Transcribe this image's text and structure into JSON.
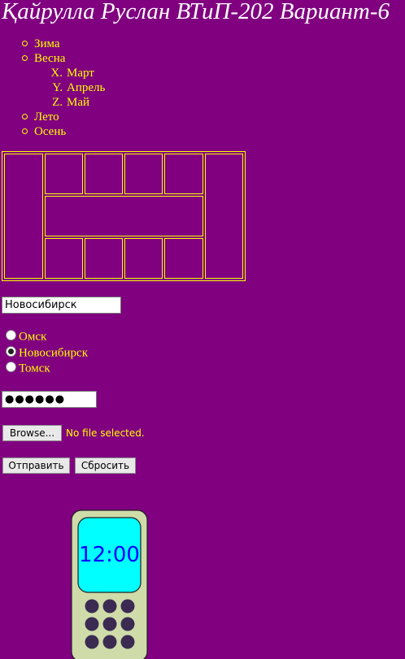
{
  "header": {
    "title": "Қайрулла Руслан ВТиП-202 Вариант-6"
  },
  "seasons": {
    "items": [
      {
        "label": "Зима"
      },
      {
        "label": "Весна",
        "months": [
          {
            "marker": "X.",
            "label": "Март"
          },
          {
            "marker": "Y.",
            "label": "Апрель"
          },
          {
            "marker": "Z.",
            "label": "Май"
          }
        ]
      },
      {
        "label": "Лето"
      },
      {
        "label": "Осень"
      }
    ]
  },
  "form": {
    "city_input_value": "Новосибирск",
    "radios": [
      {
        "label": "Омск",
        "checked": false
      },
      {
        "label": "Новосибирск",
        "checked": true
      },
      {
        "label": "Томск",
        "checked": false
      }
    ],
    "password_value": "●●●●●●",
    "file": {
      "browse_label": "Browse...",
      "status": "No file selected."
    },
    "submit_label": "Отправить",
    "reset_label": "Сбросить"
  },
  "phone": {
    "time": "12:00",
    "colors": {
      "body": "#cfdcaa",
      "screen": "#00ffff",
      "clock": "#0000ff",
      "keys": "#3b2b52"
    }
  },
  "colors": {
    "background": "#800080",
    "text": "#ffff00",
    "title": "#ffffff"
  }
}
